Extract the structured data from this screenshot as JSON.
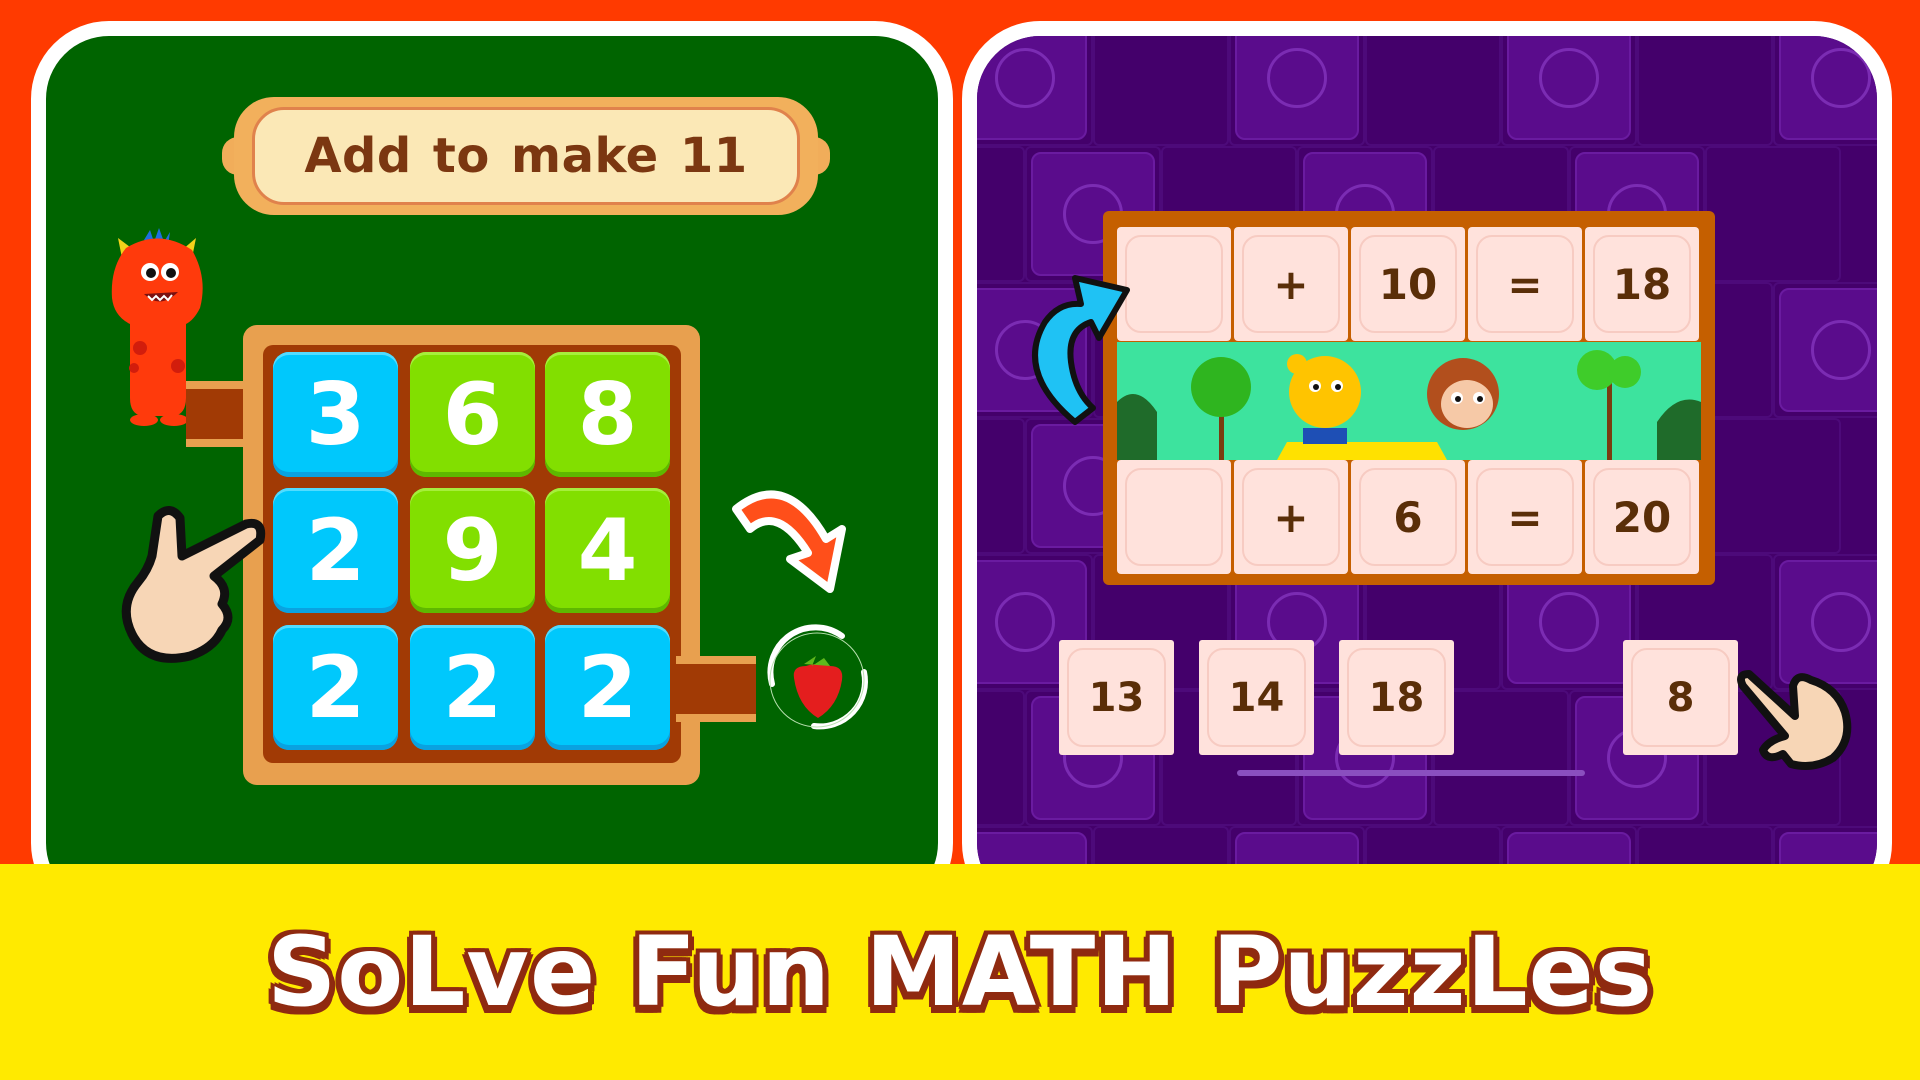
{
  "left_game": {
    "instruction": "Add to make 11",
    "target_sum": 11,
    "grid": [
      {
        "value": "3",
        "color": "blue"
      },
      {
        "value": "6",
        "color": "green"
      },
      {
        "value": "8",
        "color": "green"
      },
      {
        "value": "2",
        "color": "blue"
      },
      {
        "value": "9",
        "color": "green"
      },
      {
        "value": "4",
        "color": "green"
      },
      {
        "value": "2",
        "color": "blue"
      },
      {
        "value": "2",
        "color": "blue"
      },
      {
        "value": "2",
        "color": "blue"
      }
    ],
    "character": "red-monster",
    "reward_icon": "strawberry-icon"
  },
  "right_game": {
    "equations": [
      {
        "blank": "",
        "op": "+",
        "operand": "10",
        "eq": "=",
        "result": "18"
      },
      {
        "blank": "",
        "op": "+",
        "operand": "6",
        "eq": "=",
        "result": "20"
      }
    ],
    "answer_options": [
      "13",
      "14",
      "18",
      "8"
    ],
    "characters": [
      "yellow-bear",
      "brown-monkey"
    ]
  },
  "footer": {
    "headline": "SoLve Fun MATH PuzzLes"
  },
  "colors": {
    "background": "#ff3a00",
    "left_panel": "#006400",
    "right_panel": "#44006b",
    "footer": "#ffea00",
    "tile_blue": "#00c8fc",
    "tile_green": "#82df00",
    "text_brown": "#5a2e08"
  }
}
